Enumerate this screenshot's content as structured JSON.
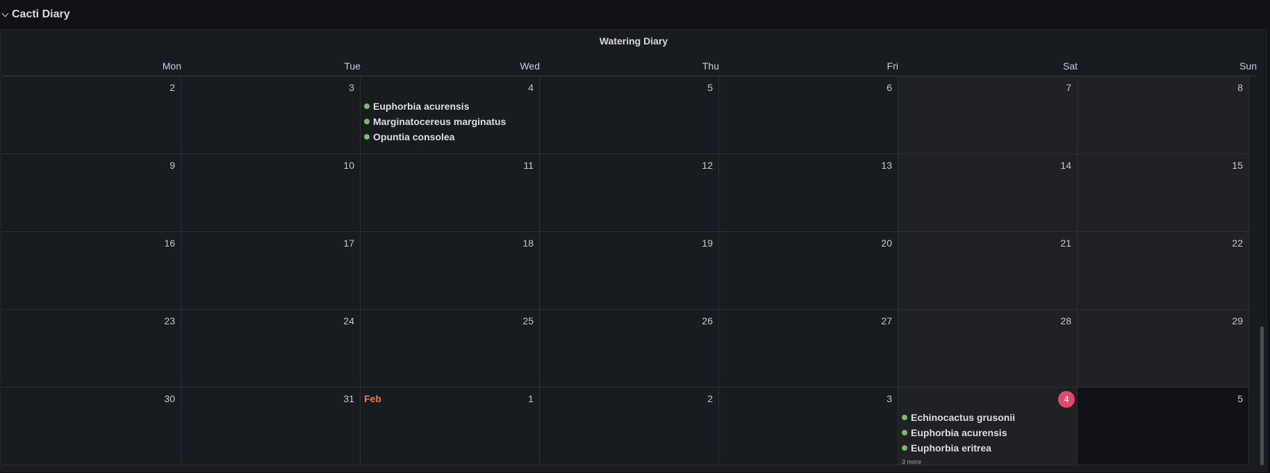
{
  "row": {
    "title": "Cacti Diary",
    "icon": "chevron-down-icon"
  },
  "panel": {
    "title": "Watering Diary"
  },
  "colors": {
    "background": "#111217",
    "panel": "#181b1f",
    "weekend": "#1f2127",
    "event_dot": "#73bf69",
    "today_badge": "#e8466e",
    "month_label": "#f07a37"
  },
  "weekdays": [
    "Mon",
    "Tue",
    "Wed",
    "Thu",
    "Fri",
    "Sat",
    "Sun"
  ],
  "weeks": [
    [
      {
        "day": "2"
      },
      {
        "day": "3"
      },
      {
        "day": "4",
        "events": [
          "Euphorbia acurensis",
          "Marginatocereus marginatus",
          "Opuntia consolea"
        ]
      },
      {
        "day": "5"
      },
      {
        "day": "6"
      },
      {
        "day": "7"
      },
      {
        "day": "8"
      }
    ],
    [
      {
        "day": "9"
      },
      {
        "day": "10"
      },
      {
        "day": "11"
      },
      {
        "day": "12"
      },
      {
        "day": "13"
      },
      {
        "day": "14"
      },
      {
        "day": "15"
      }
    ],
    [
      {
        "day": "16"
      },
      {
        "day": "17"
      },
      {
        "day": "18"
      },
      {
        "day": "19"
      },
      {
        "day": "20"
      },
      {
        "day": "21"
      },
      {
        "day": "22"
      }
    ],
    [
      {
        "day": "23"
      },
      {
        "day": "24"
      },
      {
        "day": "25"
      },
      {
        "day": "26"
      },
      {
        "day": "27"
      },
      {
        "day": "28"
      },
      {
        "day": "29"
      }
    ],
    [
      {
        "day": "30"
      },
      {
        "day": "31"
      },
      {
        "day": "1",
        "month_label": "Feb"
      },
      {
        "day": "2"
      },
      {
        "day": "3"
      },
      {
        "day": "4",
        "today": true,
        "events": [
          "Echinocactus grusonii",
          "Euphorbia acurensis",
          "Euphorbia eritrea"
        ],
        "more": "3 more"
      },
      {
        "day": "5",
        "out": true
      }
    ]
  ]
}
